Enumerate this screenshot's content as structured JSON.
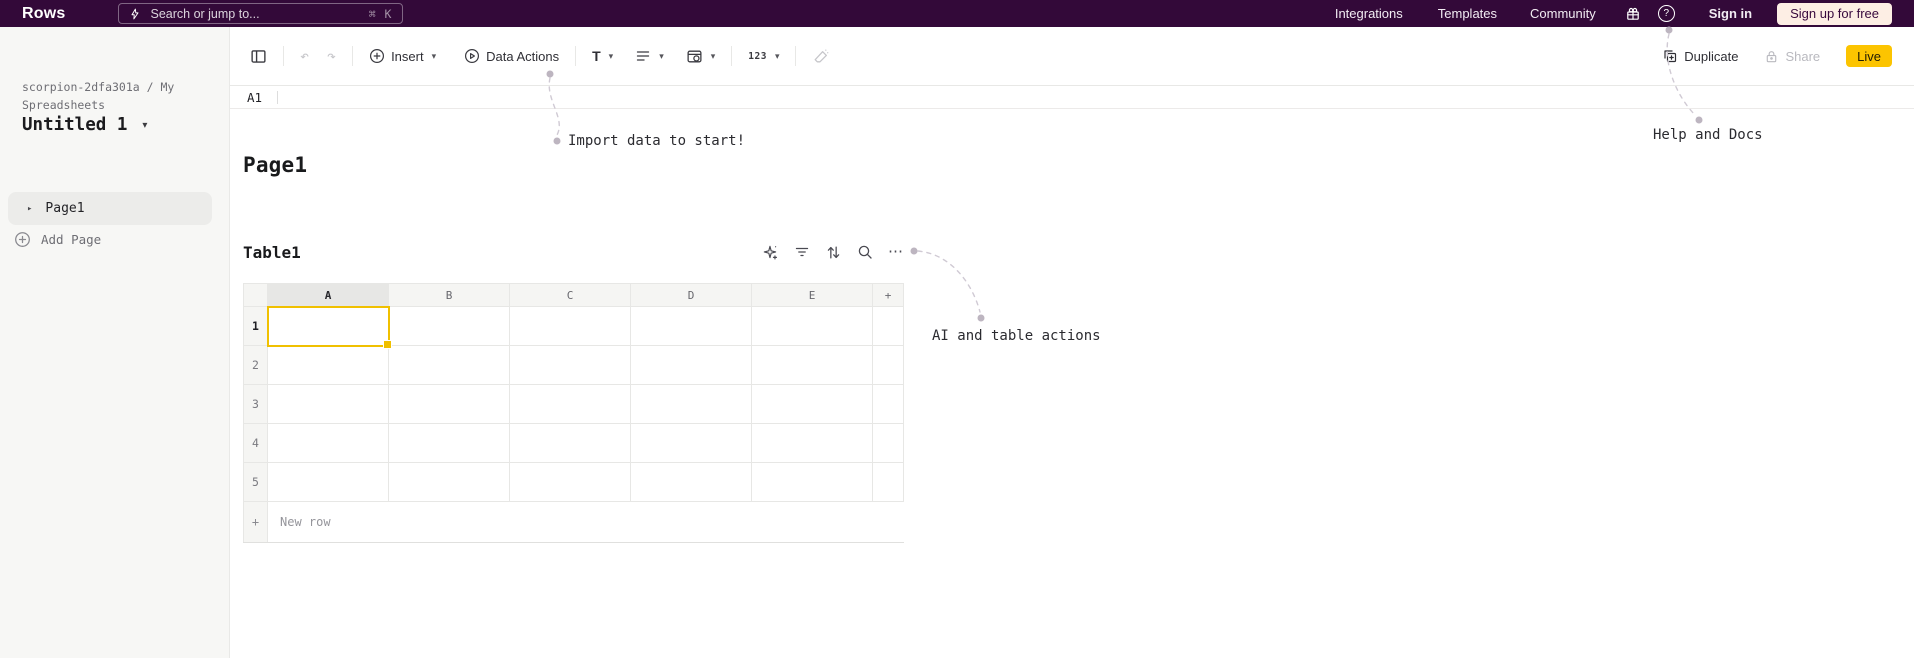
{
  "topbar": {
    "logo": "Rows",
    "search": {
      "placeholder": "Search or jump to...",
      "shortcut": "⌘ K"
    },
    "nav": [
      {
        "label": "Integrations"
      },
      {
        "label": "Templates"
      },
      {
        "label": "Community"
      }
    ],
    "help_glyph": "?",
    "sign_in": "Sign in",
    "sign_up": "Sign up for free"
  },
  "sidebar": {
    "breadcrumb": "scorpion-2dfa301a / My Spreadsheets",
    "workbook_title": "Untitled 1",
    "pages": [
      {
        "label": "Page1"
      }
    ],
    "add_page_label": "Add Page"
  },
  "toolbar": {
    "insert_label": "Insert",
    "data_actions_label": "Data Actions",
    "text_format_label": "T",
    "number_format_label": "123",
    "duplicate_label": "Duplicate",
    "share_label": "Share",
    "live_label": "Live"
  },
  "formula_bar": {
    "cell_ref": "A1"
  },
  "page": {
    "title": "Page1",
    "table": {
      "title": "Table1",
      "columns": [
        "A",
        "B",
        "C",
        "D",
        "E"
      ],
      "add_column_glyph": "+",
      "row_numbers": [
        "1",
        "2",
        "3",
        "4",
        "5"
      ],
      "cells": [
        [
          "",
          "",
          "",
          "",
          ""
        ],
        [
          "",
          "",
          "",
          "",
          ""
        ],
        [
          "",
          "",
          "",
          "",
          ""
        ],
        [
          "",
          "",
          "",
          "",
          ""
        ],
        [
          "",
          "",
          "",
          "",
          ""
        ]
      ],
      "selected_cell": "A1",
      "new_row_glyph": "+",
      "new_row_label": "New row"
    }
  },
  "annotations": [
    {
      "label": "Import data to start!"
    },
    {
      "label": "Help and Docs"
    },
    {
      "label": "AI and table actions"
    }
  ],
  "icons": {
    "caret_down": "▾",
    "triangle_right": "▸",
    "ellipsis": "⋯",
    "undo": "↶",
    "redo": "↷",
    "sort": "↑↓"
  },
  "colors": {
    "topbar_bg": "#330939",
    "accent_yellow": "#f0c000",
    "live_badge_bg": "#fcc400",
    "signup_bg": "#fdeee4",
    "sidebar_bg": "#f7f7f5",
    "grid_line": "#e7e7e5",
    "annotation_line": "#d0cad4"
  }
}
